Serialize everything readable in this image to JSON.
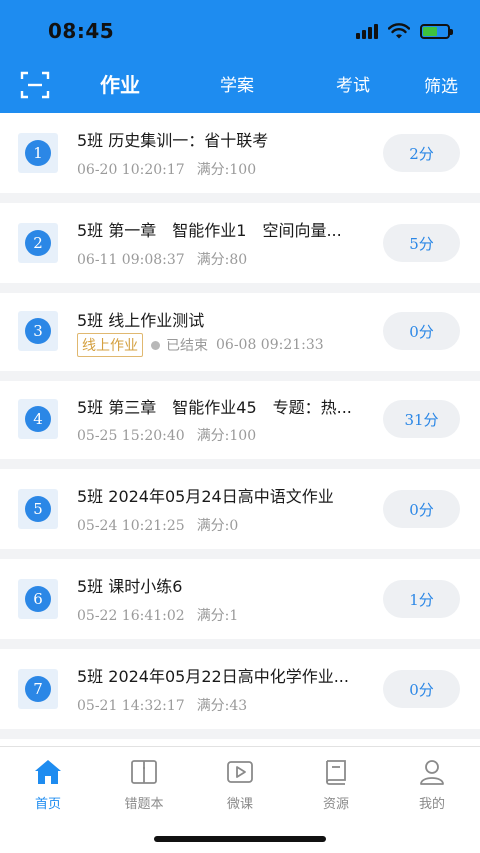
{
  "status": {
    "time": "08:45"
  },
  "nav": {
    "tabs": [
      {
        "label": "作业",
        "active": true
      },
      {
        "label": "学案",
        "active": false
      },
      {
        "label": "考试",
        "active": false
      }
    ],
    "filter_label": "筛选"
  },
  "homework": [
    {
      "num": "1",
      "title": "5班 历史集训一：省十联考",
      "date": "06-20 10:20:17",
      "full_score": "满分:100",
      "score": "2分"
    },
    {
      "num": "2",
      "title": "5班 第一章　智能作业1　空间向量...",
      "date": "06-11 09:08:37",
      "full_score": "满分:80",
      "score": "5分"
    },
    {
      "num": "3",
      "title": "5班 线上作业测试",
      "tag": "线上作业",
      "status": "已结束",
      "end_date": "06-08 09:21:33",
      "score": "0分"
    },
    {
      "num": "4",
      "title": "5班 第三章　智能作业45　专题：热...",
      "date": "05-25 15:20:40",
      "full_score": "满分:100",
      "score": "31分"
    },
    {
      "num": "5",
      "title": "5班 2024年05月24日高中语文作业",
      "date": "05-24 10:21:25",
      "full_score": "满分:0",
      "score": "0分"
    },
    {
      "num": "6",
      "title": "5班 课时小练6",
      "date": "05-22 16:41:02",
      "full_score": "满分:1",
      "score": "1分"
    },
    {
      "num": "7",
      "title": "5班 2024年05月22日高中化学作业...",
      "date": "05-21 14:32:17",
      "full_score": "满分:43",
      "score": "0分"
    }
  ],
  "tabbar": [
    {
      "label": "首页",
      "icon": "home-icon",
      "active": true
    },
    {
      "label": "错题本",
      "icon": "book-open-icon",
      "active": false
    },
    {
      "label": "微课",
      "icon": "video-icon",
      "active": false
    },
    {
      "label": "资源",
      "icon": "resource-book-icon",
      "active": false
    },
    {
      "label": "我的",
      "icon": "person-icon",
      "active": false
    }
  ],
  "colors": {
    "primary": "#1e8cf0",
    "score_text": "#2b87e6",
    "tag_online": "#d4a040"
  }
}
